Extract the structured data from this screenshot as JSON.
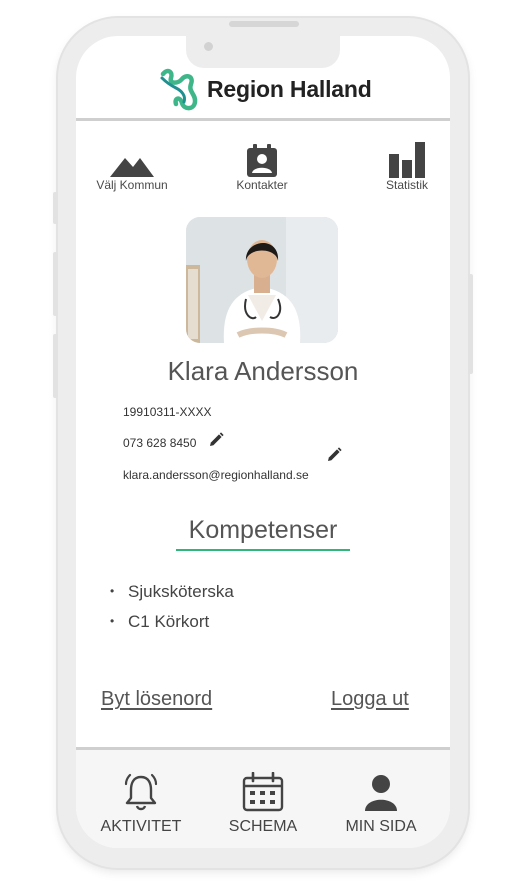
{
  "brand": {
    "name": "Region Halland",
    "logo_icon": "region-halland-logo",
    "colors": {
      "logo_green": "#3fb68a",
      "logo_teal": "#1f8f8f",
      "accent": "#2fb67a"
    }
  },
  "top_nav": {
    "items": [
      {
        "label": "Välj Kommun",
        "icon": "mountain-icon"
      },
      {
        "label": "Kontakter",
        "icon": "contacts-icon"
      },
      {
        "label": "Statistik",
        "icon": "bar-chart-icon"
      }
    ]
  },
  "profile": {
    "name": "Klara Andersson",
    "personal_number": "19910311-XXXX",
    "phone": "073 628 8450",
    "email": "klara.andersson@regionhalland.se"
  },
  "competences": {
    "title": "Kompetenser",
    "items": [
      "Sjuksköterska",
      "C1 Körkort"
    ]
  },
  "actions": {
    "change_password": "Byt lösenord",
    "logout": "Logga ut"
  },
  "bottom_nav": {
    "items": [
      {
        "label": "AKTIVITET",
        "icon": "bell-icon"
      },
      {
        "label": "SCHEMA",
        "icon": "calendar-icon"
      },
      {
        "label": "MIN SIDA",
        "icon": "user-icon"
      }
    ]
  }
}
